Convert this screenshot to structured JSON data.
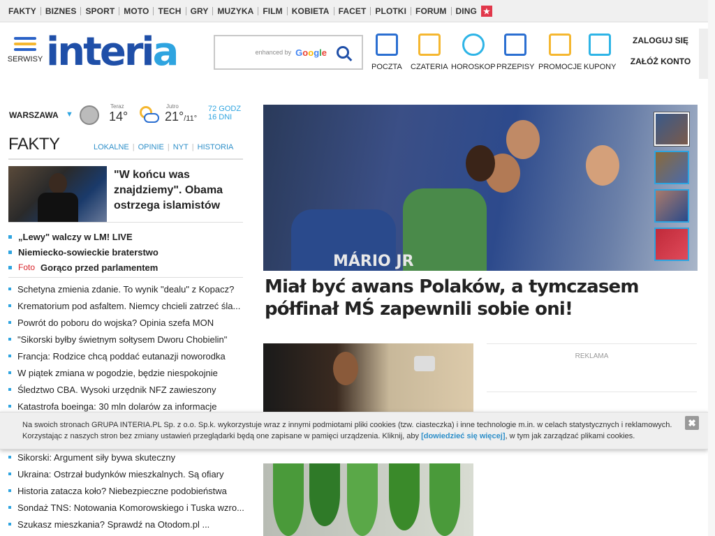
{
  "topnav": [
    "FAKTY",
    "BIZNES",
    "SPORT",
    "MOTO",
    "TECH",
    "GRY",
    "MUZYKA",
    "FILM",
    "KOBIETA",
    "FACET",
    "PLOTKI",
    "FORUM",
    "DING"
  ],
  "header": {
    "serwisy": "SERWISY",
    "logo": "interia",
    "search": {
      "enhanced": "enhanced by",
      "google": [
        "G",
        "o",
        "o",
        "g",
        "l",
        "e"
      ]
    },
    "services": [
      {
        "label": "POCZTA",
        "icon": "mail-icon"
      },
      {
        "label": "CZATERIA",
        "icon": "chat-icon"
      },
      {
        "label": "HOROSKOP",
        "icon": "horoscope-icon"
      },
      {
        "label": "PRZEPISY",
        "icon": "recipes-icon"
      },
      {
        "label": "PROMOCJE",
        "icon": "percent-icon"
      },
      {
        "label": "KUPONY",
        "icon": "coupon-icon"
      }
    ],
    "login": "ZALOGUJ SIĘ",
    "register": "ZAŁÓŻ KONTO"
  },
  "weather": {
    "city": "WARSZAWA",
    "now_label": "Teraz",
    "now_temp": "14°",
    "tomorrow_label": "Jutro",
    "tomorrow_high": "21°",
    "tomorrow_low": "/11°",
    "link1": "72 GODZ",
    "link2": "16 DNI"
  },
  "fakty": {
    "title": "FAKTY",
    "sublinks": [
      "LOKALNE",
      "OPINIE",
      "NYT",
      "HISTORIA"
    ],
    "lead": "\"W końcu was znajdziemy\". Obama ostrzega islamistów",
    "bold_items": [
      {
        "tag": "",
        "text": "„Lewy\" walczy w LM! LIVE"
      },
      {
        "tag": "",
        "text": "Niemiecko-sowieckie braterstwo"
      },
      {
        "tag": "Foto",
        "text": "Gorąco przed parlamentem"
      }
    ],
    "news": [
      "Schetyna zmienia zdanie. To wynik \"dealu\" z Kopacz?",
      "Krematorium pod asfaltem. Niemcy chcieli zatrzeć śla...",
      "Powrót do poboru do wojska? Opinia szefa MON",
      "\"Sikorski byłby świetnym sołtysem Dworu Chobielin\"",
      "Francja: Rodzice chcą poddać eutanazji noworodka",
      "W piątek zmiana w pogodzie, będzie niespokojnie",
      "Śledztwo CBA. Wysoki urzędnik NFZ zawieszony",
      "Katastrofa boeinga: 30 mln dolarów za informacje"
    ],
    "news2": [
      "Sikorski: Argument siły bywa skuteczny",
      "Ukraina: Ostrzał budynków mieszkalnych. Są ofiary",
      "Historia zatacza koło? Niebezpieczne podobieństwa",
      "Sondaż TNS: Notowania Komorowskiego i Tuska wzro...",
      "Szukasz mieszkania? Sprawdź na Otodom.pl ..."
    ]
  },
  "hero": {
    "jersey_text": "MÁRIO JR",
    "title": "Miał być awans Polaków, a tymczasem półfinał MŚ zapewnili sobie oni!"
  },
  "ad": {
    "label": "REKLAMA"
  },
  "cookie": {
    "text1": "Na swoich stronach GRUPA INTERIA.PL Sp. z o.o. Sp.k. wykorzystuje wraz z innymi podmiotami pliki cookies (tzw. ciasteczka) i inne technologie m.in. w celach statystycznych i reklamowych. Korzystając z naszych stron bez zmiany ustawień przeglądarki będą one zapisane w pamięci urządzenia. Kliknij, aby ",
    "link": "[dowiedzieć się więcej]",
    "text2": ", w tym jak zarządzać plikami cookies.",
    "close": "✖"
  }
}
